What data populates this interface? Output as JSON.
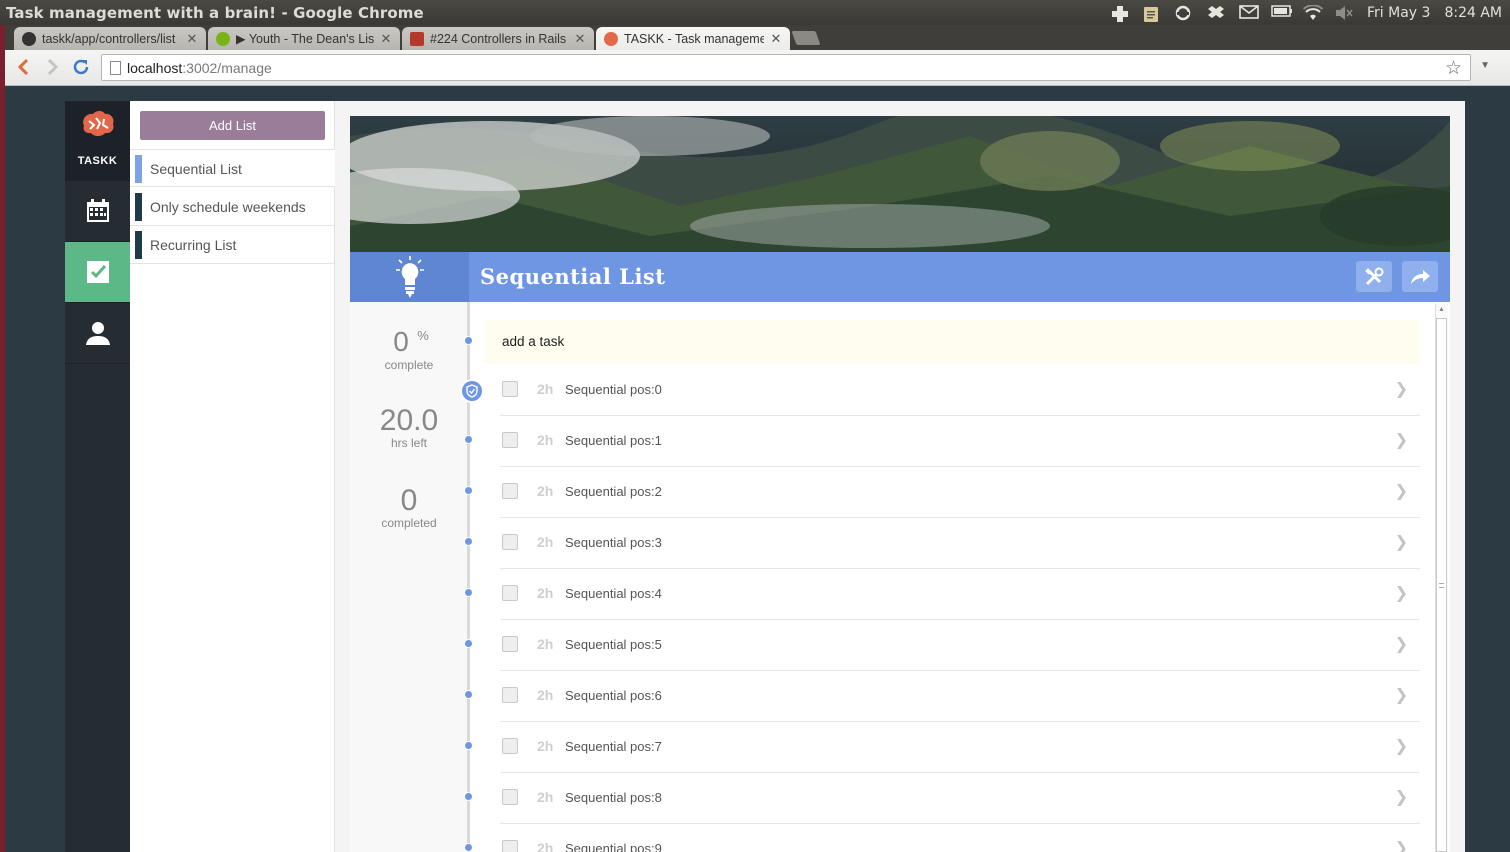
{
  "window": {
    "title": "Task management with a brain! - Google Chrome"
  },
  "tray": {
    "datetime_day": "Fri May 3",
    "time": "8:24 AM"
  },
  "tabs": [
    {
      "label": "taskk/app/controllers/list",
      "favicon_color": "#333333"
    },
    {
      "label": "▶ Youth - The Dean's List",
      "favicon_color": "#7ab317"
    },
    {
      "label": "#224 Controllers in Rails",
      "favicon_color": "#b33a2a"
    },
    {
      "label": "TASKK - Task managemen",
      "favicon_color": "#e26a4a"
    }
  ],
  "address_bar": {
    "host": "localhost",
    "path": ":3002/manage"
  },
  "app": {
    "brand": "TASKK",
    "colors": {
      "accent": "#6f96e2",
      "active_rail": "#5cb887",
      "add_list": "#9a7d99"
    },
    "rail": [
      {
        "name": "calendar-icon",
        "active": false
      },
      {
        "name": "checkbox-icon",
        "active": true
      },
      {
        "name": "user-icon",
        "active": false
      }
    ]
  },
  "lists": {
    "add_label": "Add List",
    "items": [
      {
        "label": "Sequential List",
        "active": true
      },
      {
        "label": "Only schedule weekends",
        "active": false
      },
      {
        "label": "Recurring List",
        "active": false
      }
    ]
  },
  "main": {
    "title": "Sequential List",
    "stats": {
      "percent": "0",
      "percent_sign": "%",
      "percent_label": "complete",
      "hours": "20.0",
      "hours_label": "hrs left",
      "completed": "0",
      "completed_label": "completed"
    },
    "add_task_label": "add a task",
    "tasks": [
      {
        "hours": "2h",
        "name": "Sequential pos:0"
      },
      {
        "hours": "2h",
        "name": "Sequential pos:1"
      },
      {
        "hours": "2h",
        "name": "Sequential pos:2"
      },
      {
        "hours": "2h",
        "name": "Sequential pos:3"
      },
      {
        "hours": "2h",
        "name": "Sequential pos:4"
      },
      {
        "hours": "2h",
        "name": "Sequential pos:5"
      },
      {
        "hours": "2h",
        "name": "Sequential pos:6"
      },
      {
        "hours": "2h",
        "name": "Sequential pos:7"
      },
      {
        "hours": "2h",
        "name": "Sequential pos:8"
      },
      {
        "hours": "2h",
        "name": "Sequential pos:9"
      }
    ]
  }
}
